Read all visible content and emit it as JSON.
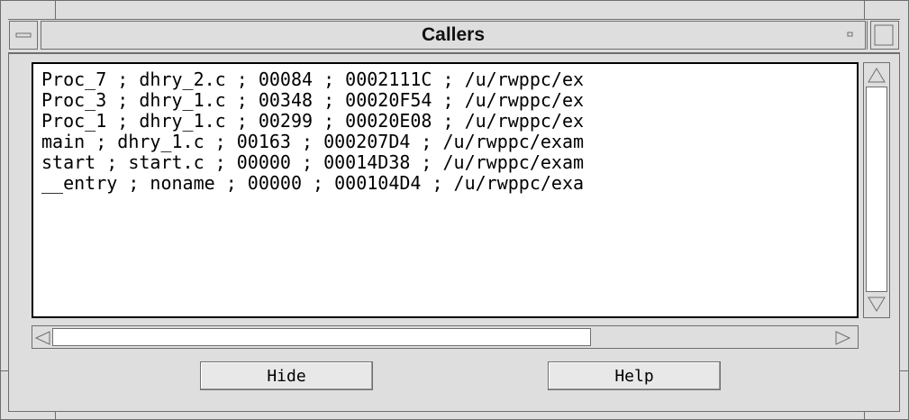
{
  "window": {
    "title": "Callers"
  },
  "callers": [
    "Proc_7 ; dhry_2.c ; 00084 ; 0002111C ; /u/rwppc/ex",
    "Proc_3 ; dhry_1.c ; 00348 ; 00020F54 ; /u/rwppc/ex",
    "Proc_1 ; dhry_1.c ; 00299 ; 00020E08 ; /u/rwppc/ex",
    "main ; dhry_1.c ; 00163 ; 000207D4 ; /u/rwppc/exam",
    "start ; start.c ; 00000 ; 00014D38 ; /u/rwppc/exam",
    "__entry ; noname ; 00000 ; 000104D4 ; /u/rwppc/exa"
  ],
  "buttons": {
    "hide": "Hide",
    "help": "Help"
  },
  "icons": {
    "window_menu": "window-menu-icon",
    "minimize": "minimize-icon",
    "maximize": "maximize-icon",
    "scroll_up": "scroll-up-arrow-icon",
    "scroll_down": "scroll-down-arrow-icon",
    "scroll_left": "scroll-left-arrow-icon",
    "scroll_right": "scroll-right-arrow-icon"
  },
  "colors": {
    "frame": "#dedede",
    "border": "#6e6e6e",
    "text_bg": "#ffffff"
  }
}
